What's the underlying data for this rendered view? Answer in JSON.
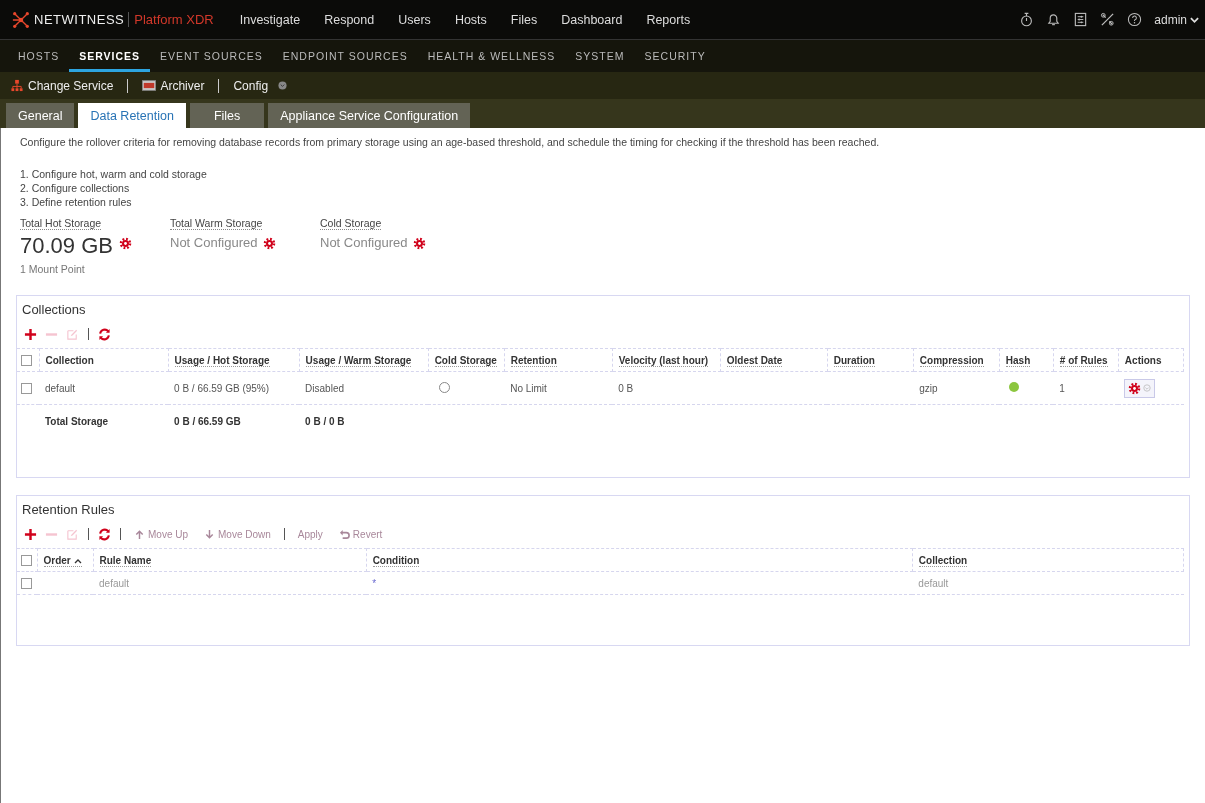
{
  "app": {
    "brand": "NETWITNESS",
    "product": "Platform XDR"
  },
  "main_nav": [
    {
      "label": "Investigate"
    },
    {
      "label": "Respond"
    },
    {
      "label": "Users"
    },
    {
      "label": "Hosts"
    },
    {
      "label": "Files"
    },
    {
      "label": "Dashboard"
    },
    {
      "label": "Reports"
    }
  ],
  "user": {
    "name": "admin"
  },
  "admin_nav": [
    {
      "label": "HOSTS",
      "selected": false
    },
    {
      "label": "SERVICES",
      "selected": true
    },
    {
      "label": "EVENT SOURCES",
      "selected": false
    },
    {
      "label": "ENDPOINT SOURCES",
      "selected": false
    },
    {
      "label": "HEALTH & WELLNESS",
      "selected": false
    },
    {
      "label": "SYSTEM",
      "selected": false
    },
    {
      "label": "SECURITY",
      "selected": false
    }
  ],
  "service_bar": {
    "change_service": "Change Service",
    "service": "Archiver",
    "view": "Config"
  },
  "tabs": [
    {
      "label": "General",
      "selected": false
    },
    {
      "label": "Data Retention",
      "selected": true
    },
    {
      "label": "Files",
      "selected": false
    },
    {
      "label": "Appliance Service Configuration",
      "selected": false
    }
  ],
  "description": "Configure the rollover criteria for removing database records from primary storage using an age-based threshold, and schedule the timing for checking if the threshold has been reached.",
  "steps": [
    "1. Configure hot, warm and cold storage",
    "2. Configure collections",
    "3. Define retention rules"
  ],
  "storage": [
    {
      "label": "Total Hot Storage",
      "value": "70.09 GB",
      "configured": true,
      "note": "1 Mount Point"
    },
    {
      "label": "Total Warm Storage",
      "value": "Not Configured",
      "configured": false
    },
    {
      "label": "Cold Storage",
      "value": "Not Configured",
      "configured": false
    }
  ],
  "collections": {
    "title": "Collections",
    "all_selected": false,
    "toolbar": [
      {
        "kind": "add",
        "disabled": false
      },
      {
        "kind": "remove",
        "disabled": true
      },
      {
        "kind": "edit",
        "disabled": true
      },
      {
        "kind": "separator"
      },
      {
        "kind": "refresh",
        "disabled": false
      }
    ],
    "columns": [
      "Collection",
      "Usage / Hot Storage",
      "Usage / Warm Storage",
      "Cold Storage",
      "Retention",
      "Velocity (last hour)",
      "Oldest Date",
      "Duration",
      "Compression",
      "Hash",
      "# of Rules",
      "Actions"
    ],
    "rows": [
      {
        "selected": false,
        "collection": "default",
        "usage_hot": "0 B / 66.59 GB (95%)",
        "usage_warm": "Disabled",
        "cold_storage": false,
        "retention": "No Limit",
        "velocity": "0 B",
        "compression": "gzip",
        "hash": true,
        "rules": "1"
      }
    ],
    "total": {
      "label": "Total Storage",
      "usage_hot": "0 B / 66.59 GB",
      "usage_warm": "0 B / 0 B"
    }
  },
  "retention_rules": {
    "title": "Retention Rules",
    "all_selected": false,
    "toolbar": [
      {
        "kind": "add",
        "disabled": false
      },
      {
        "kind": "remove",
        "disabled": true
      },
      {
        "kind": "edit",
        "disabled": true
      },
      {
        "kind": "separator"
      },
      {
        "kind": "refresh",
        "disabled": false
      },
      {
        "kind": "separator"
      },
      {
        "kind": "move_up",
        "label": "Move Up",
        "disabled": true
      },
      {
        "kind": "move_down",
        "label": "Move Down",
        "disabled": true
      },
      {
        "kind": "separator"
      },
      {
        "kind": "apply",
        "label": "Apply",
        "disabled": true
      },
      {
        "kind": "revert",
        "label": "Revert",
        "disabled": true
      }
    ],
    "columns": [
      {
        "label": "Order",
        "sorted": true
      },
      {
        "label": "Rule Name",
        "sorted": false
      },
      {
        "label": "Condition",
        "sorted": false
      },
      {
        "label": "Collection",
        "sorted": false
      }
    ],
    "rows": [
      {
        "selected": false,
        "rule_name": "default",
        "condition": "*",
        "collection": "default"
      }
    ]
  }
}
